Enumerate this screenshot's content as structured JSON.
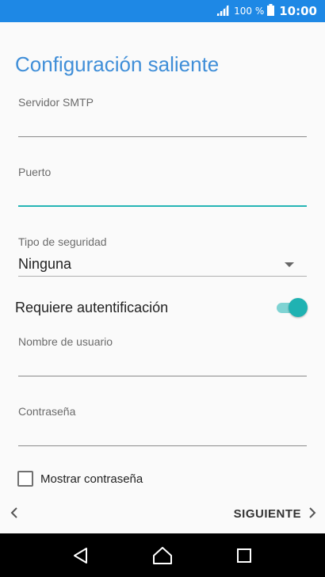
{
  "status_bar": {
    "battery_percent": "100 %",
    "time": "10:00",
    "icons": [
      "signal-icon",
      "battery-icon"
    ]
  },
  "page": {
    "title": "Configuración saliente"
  },
  "fields": {
    "smtp_server": {
      "label": "Servidor SMTP",
      "value": ""
    },
    "port": {
      "label": "Puerto",
      "value": ""
    },
    "username": {
      "label": "Nombre de usuario",
      "value": ""
    },
    "password": {
      "label": "Contraseña",
      "value": ""
    }
  },
  "security": {
    "label": "Tipo de seguridad",
    "selected": "Ninguna"
  },
  "auth_toggle": {
    "label": "Requiere autentificación",
    "enabled": true,
    "color": "#1fb2b2"
  },
  "show_password": {
    "label": "Mostrar contraseña",
    "checked": false
  },
  "wizard": {
    "next_label": "SIGUIENTE"
  },
  "colors": {
    "status_bar": "#1e88e5",
    "title": "#3f8ed8",
    "focus_accent": "#26b5b5"
  }
}
